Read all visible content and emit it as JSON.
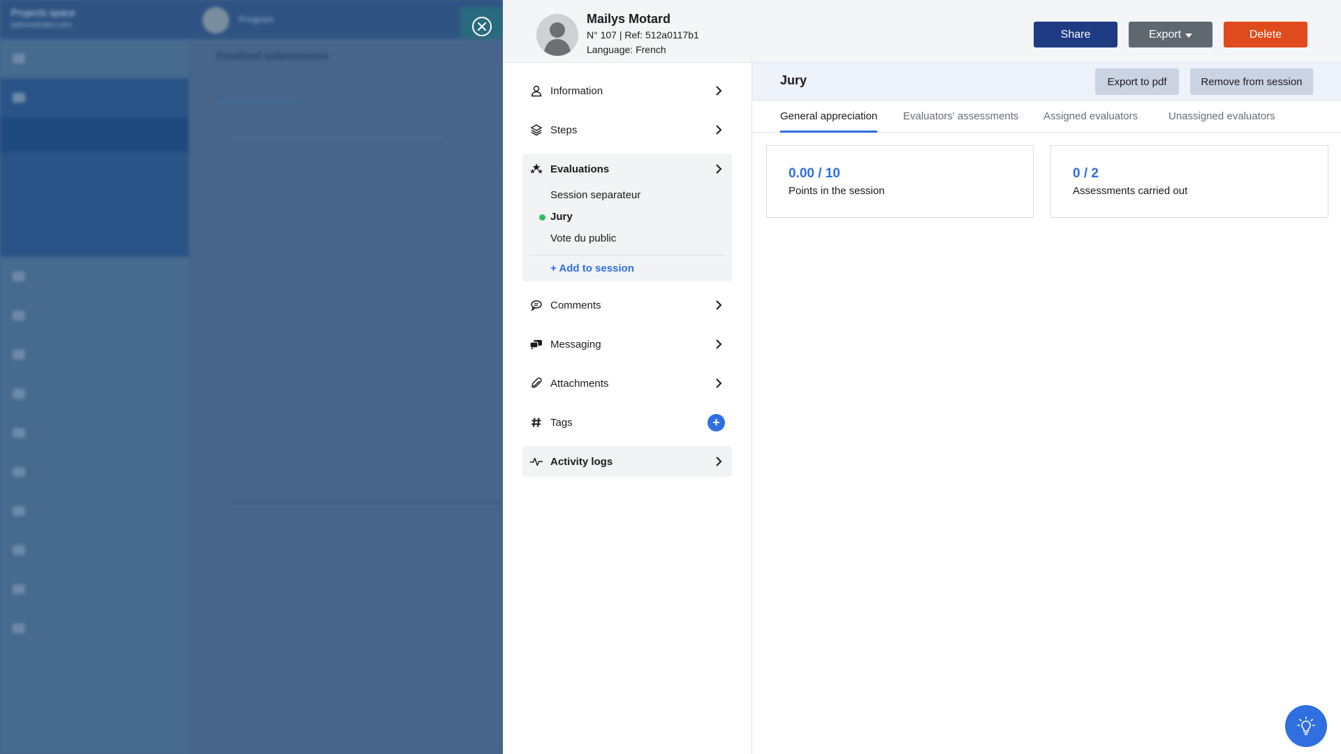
{
  "background": {
    "brand_title": "Projects space",
    "brand_subtitle": "administrator.com",
    "top_label": "Program",
    "main_title": "Finalized submissions"
  },
  "header": {
    "name": "Mailys Motard",
    "ref_line": "N° 107 | Ref: 512a0117b1",
    "language_line": "Language: French",
    "share_label": "Share",
    "export_label": "Export",
    "delete_label": "Delete"
  },
  "nav": {
    "information": "Information",
    "steps": "Steps",
    "evaluations": "Evaluations",
    "sessions": [
      {
        "label": "Session separateur",
        "active": false
      },
      {
        "label": "Jury",
        "active": true
      },
      {
        "label": "Vote du public",
        "active": false
      }
    ],
    "add_session": "+ Add to session",
    "comments": "Comments",
    "messaging": "Messaging",
    "attachments": "Attachments",
    "tags": "Tags",
    "tags_add": "+",
    "activity_logs": "Activity logs"
  },
  "content": {
    "title": "Jury",
    "export_pdf_label": "Export to pdf",
    "remove_label": "Remove from session",
    "tabs": [
      {
        "label": "General appreciation",
        "active": true
      },
      {
        "label": "Evaluators' assessments",
        "active": false
      },
      {
        "label": "Assigned evaluators",
        "active": false
      },
      {
        "label": "Unassigned evaluators",
        "active": false
      }
    ],
    "cards": [
      {
        "value": "0.00 / 10",
        "caption": "Points in the session"
      },
      {
        "value": "0 / 2",
        "caption": "Assessments carried out"
      }
    ]
  },
  "colors": {
    "accent": "#2f6fe0",
    "share": "#1d3a82",
    "export": "#5f6771",
    "delete": "#e04b1d",
    "active_dot": "#2fbf5f"
  },
  "icons": {
    "close": "close-icon",
    "help": "lightbulb-icon"
  }
}
